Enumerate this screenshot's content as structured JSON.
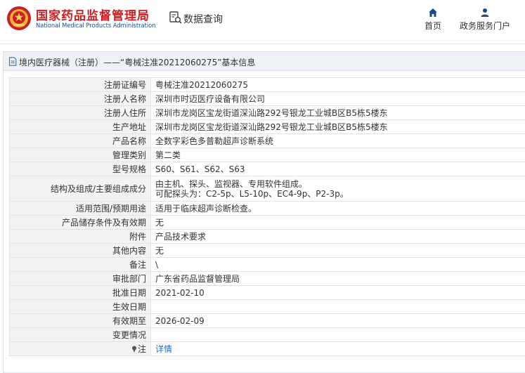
{
  "header": {
    "title_cn": "国家药品监督管理局",
    "title_en": "National Medical Products Administration",
    "search_label": "数据查询",
    "nav": {
      "home": "首页",
      "services": "政务服务门户"
    }
  },
  "colors": {
    "brand_red": "#cc1f24",
    "brand_blue": "#1a4a8c",
    "link_blue": "#1a6fc6",
    "label_bg": "#f3f3f3"
  },
  "icons": {
    "logo": "emblem-logo",
    "search": "data-search-icon",
    "home": "home-icon",
    "services": "user-icon",
    "panel": "document-icon",
    "note": "pin-icon"
  },
  "panel": {
    "title": "境内医疗器械（注册）——“粤械注准20212060275”基本信息"
  },
  "rows": [
    {
      "label": "注册证编号",
      "value": "粤械注准20212060275"
    },
    {
      "label": "注册人名称",
      "value": "深圳市时迈医疗设备有限公司"
    },
    {
      "label": "注册人住所",
      "value": "深圳市龙岗区宝龙街道深汕路292号银龙工业城B区B5栋5楼东"
    },
    {
      "label": "生产地址",
      "value": "深圳市龙岗区宝龙街道深汕路292号银龙工业城B区B5栋5楼东"
    },
    {
      "label": "产品名称",
      "value": "全数字彩色多普勒超声诊断系统"
    },
    {
      "label": "管理类别",
      "value": "第二类"
    },
    {
      "label": "型号规格",
      "value": "S60、S61、S62、S63"
    },
    {
      "label": "结构及组成/主要组成成分",
      "value_line1": "由主机、探头、监视器、专用软件组成。",
      "value_line2": "可配探头为：C2-5p、L5-10p、EC4-9p、P2-3p。"
    },
    {
      "label": "适用范围/预期用途",
      "value": "适用于临床超声诊断检查。"
    },
    {
      "label": "产品储存条件及有效期",
      "value": "无"
    },
    {
      "label": "附件",
      "value": "产品技术要求"
    },
    {
      "label": "其他内容",
      "value": "无"
    },
    {
      "label": "备注",
      "value": "\\"
    },
    {
      "label": "审批部门",
      "value": "广东省药品监督管理局"
    },
    {
      "label": "批准日期",
      "value": "2021-02-10"
    },
    {
      "label": "生效日期",
      "value": ""
    },
    {
      "label": "有效期至",
      "value": "2026-02-09"
    },
    {
      "label": "变更情况",
      "value": ""
    },
    {
      "label": "注",
      "value": "详情"
    }
  ]
}
